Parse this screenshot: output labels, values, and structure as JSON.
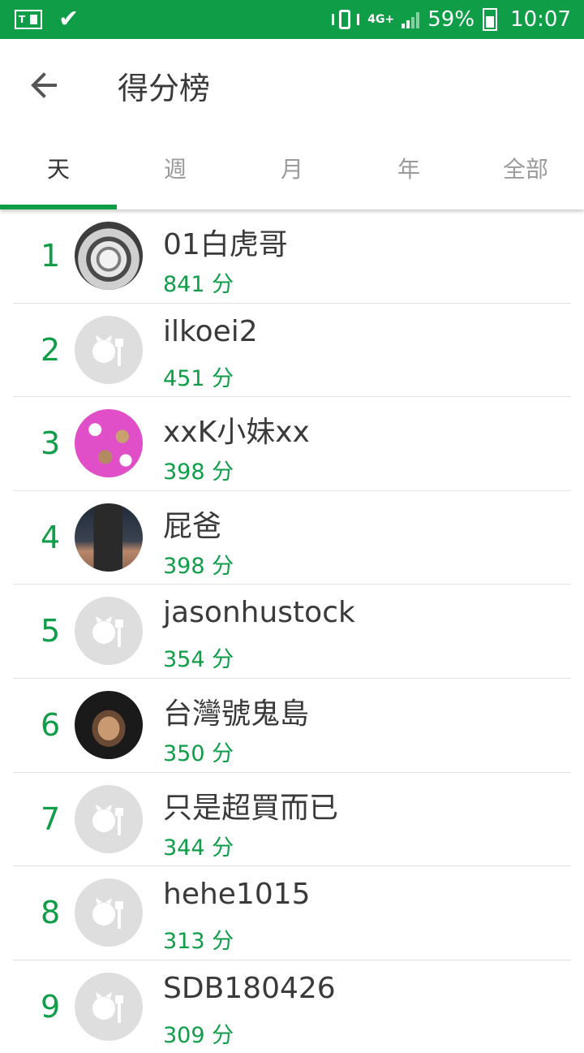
{
  "status_bar": {
    "battery": "59%",
    "time": "10:07",
    "network": "4G+"
  },
  "header": {
    "title": "得分榜"
  },
  "tabs": [
    {
      "label": "天",
      "active": true
    },
    {
      "label": "週",
      "active": false
    },
    {
      "label": "月",
      "active": false
    },
    {
      "label": "年",
      "active": false
    },
    {
      "label": "全部",
      "active": false
    }
  ],
  "leaderboard": [
    {
      "rank": "1",
      "name": "01白虎哥",
      "score": "841 分",
      "avatar": "tiger-photo"
    },
    {
      "rank": "2",
      "name": "ilkoei2",
      "score": "451 分",
      "avatar": "default"
    },
    {
      "rank": "3",
      "name": "xxK小妹xx",
      "score": "398 分",
      "avatar": "pink-pattern"
    },
    {
      "rank": "4",
      "name": "屁爸",
      "score": "398 分",
      "avatar": "cup-photo"
    },
    {
      "rank": "5",
      "name": "jasonhustock",
      "score": "354 分",
      "avatar": "default"
    },
    {
      "rank": "6",
      "name": "台灣號鬼島",
      "score": "350 分",
      "avatar": "person-photo"
    },
    {
      "rank": "7",
      "name": "只是超買而已",
      "score": "344 分",
      "avatar": "default"
    },
    {
      "rank": "8",
      "name": "hehe1015",
      "score": "313 分",
      "avatar": "default"
    },
    {
      "rank": "9",
      "name": "SDB180426",
      "score": "309 分",
      "avatar": "default"
    }
  ],
  "colors": {
    "accent": "#0f9d48",
    "text": "#3a3a3a",
    "tab_inactive": "#9a9a9a",
    "avatar_default": "#dedede"
  }
}
